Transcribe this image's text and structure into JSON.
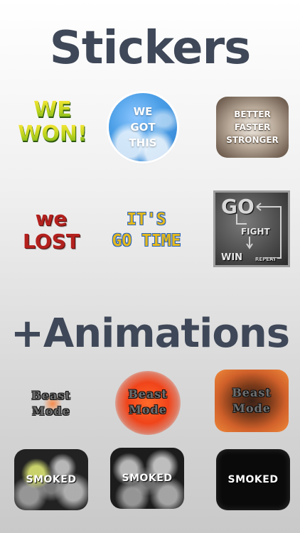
{
  "headings": {
    "stickers": "Stickers",
    "animations": "+Animations"
  },
  "stickers": {
    "we_won": [
      "WE",
      "WON!"
    ],
    "we_got_this": [
      "WE",
      "GOT",
      "THIS"
    ],
    "better_faster_stronger": [
      "BETTER",
      "FASTER",
      "STRONGER"
    ],
    "we_lost": [
      "we",
      "LOST"
    ],
    "its_go_time": [
      "IT'S",
      "GO TIME"
    ],
    "go_fight_win": {
      "go": "GO",
      "fight": "FIGHT",
      "win": "WIN",
      "repeat": "REPEAT"
    }
  },
  "animations": {
    "beast_mode": [
      "Beast",
      "Mode"
    ],
    "smoked": "SMOKED"
  },
  "colors": {
    "heading": "#3f4858",
    "we_won": "#b9d21d",
    "we_lost": "#b3211e",
    "go_time": "#e3b81d",
    "sky": "#4a9ee6"
  }
}
